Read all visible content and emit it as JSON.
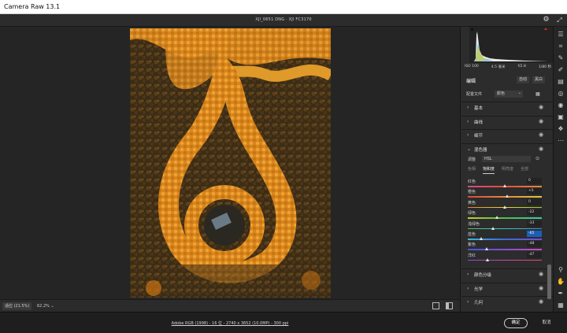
{
  "window": {
    "title": "Camera Raw 13.1"
  },
  "topbar": {
    "filename": "XJI_0651 DNG · XJI FC3170"
  },
  "bottombar": {
    "zoom_fit": "适应 (21.5%)",
    "zoom_level": "62.2% ⌄"
  },
  "footer": {
    "info": "Adobe RGB (1998) - 16 位 - 2740 x 3652 (10.0MP) - 300 ppi",
    "ok": "确定",
    "cancel": "取消"
  },
  "exif": {
    "iso": "ISO 100",
    "focal": "4.5 毫米",
    "aperture": "f/2.8",
    "shutter": "1/80 秒"
  },
  "edit": {
    "title": "编辑",
    "auto": "自动",
    "bw": "黑白"
  },
  "profile": {
    "label": "配置文件",
    "value": "颜色"
  },
  "sections": {
    "basic": "基本",
    "curve": "曲线",
    "detail": "细节",
    "mixer": "混色器",
    "grading": "颜色分级",
    "optics": "光学",
    "geometry": "几何"
  },
  "mixer": {
    "adjust_label": "调整",
    "adjust_value": "HSL",
    "tabs": [
      "色相",
      "饱和度",
      "明亮度",
      "全部"
    ],
    "active_tab": 1,
    "sliders": [
      {
        "label": "红色",
        "value": "0",
        "level": 0.5
      },
      {
        "label": "橙色",
        "value": "+5",
        "level": 0.53
      },
      {
        "label": "黄色",
        "value": "0",
        "level": 0.5
      },
      {
        "label": "绿色",
        "value": "-22",
        "level": 0.39
      },
      {
        "label": "浅绿色",
        "value": "-33",
        "level": 0.34
      },
      {
        "label": "蓝色",
        "value": "-65",
        "level": 0.18
      },
      {
        "label": "紫色",
        "value": "-48",
        "level": 0.26
      },
      {
        "label": "洋红",
        "value": "-47",
        "level": 0.27
      }
    ]
  },
  "colors": {
    "accent": "#1b5fb5",
    "hist_clip": "#e0242b"
  },
  "icons": {
    "gear": "gear-icon",
    "expand": "expand-icon",
    "right_tools": [
      "edit-icon",
      "crop-icon",
      "healing-icon",
      "brush-icon",
      "gradient-icon",
      "radial-icon",
      "redeye-icon",
      "snapshots-icon",
      "presets-icon",
      "more-icon",
      "zoom-icon",
      "hand-icon",
      "sampler-icon",
      "grid-icon"
    ]
  }
}
